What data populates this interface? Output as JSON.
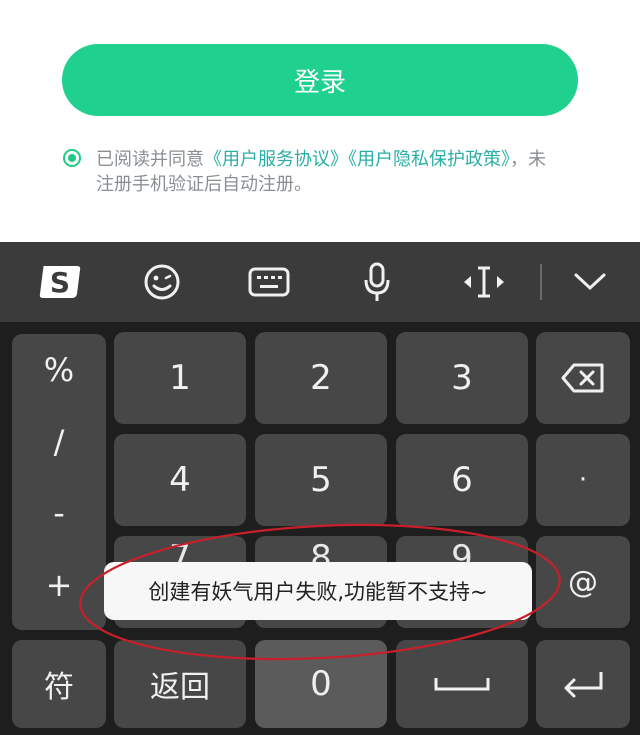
{
  "login": {
    "button_label": "登录",
    "agreement_prefix": "已阅读并同意",
    "agreement_link_1": "《用户服务协议》",
    "agreement_link_2": "《用户隐私保护政策》",
    "agreement_suffix": "，未注册手机验证后自动注册。"
  },
  "keyboard": {
    "toolbar": [
      "sogou-logo-icon",
      "emoji-icon",
      "keyboard-icon",
      "microphone-icon",
      "cursor-move-icon",
      "collapse-chevron-icon"
    ],
    "symbols": [
      "%",
      "/",
      "-",
      "+"
    ],
    "keys": {
      "k1": "1",
      "k2": "2",
      "k3": "3",
      "k4": "4",
      "k5": "5",
      "k6": "6",
      "k7": "7",
      "k8": "8",
      "k9": "9",
      "k0": "0",
      "dot": "·",
      "at": "@",
      "symbol_key": "符",
      "back_key": "返回"
    }
  },
  "toast": {
    "message": "创建有妖气用户失败,功能暂不支持~"
  },
  "colors": {
    "accent_green": "#1fd08f",
    "link_teal": "#2aaea8",
    "keyboard_bg": "#1e1e1e",
    "key_bg": "#474747",
    "annotation_red": "#c8202a"
  }
}
